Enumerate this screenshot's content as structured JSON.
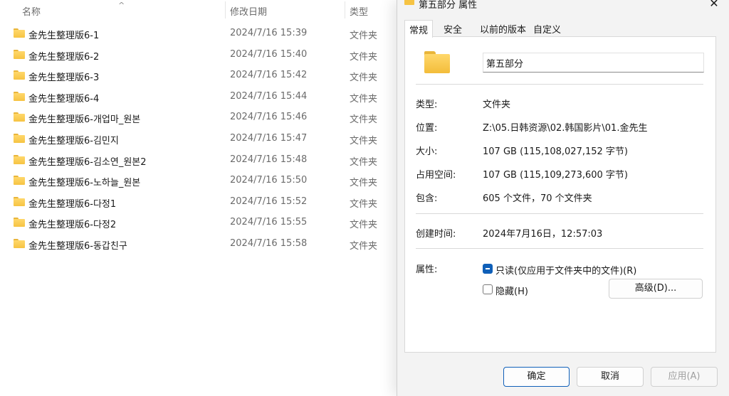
{
  "explorer": {
    "columns": {
      "name": "名称",
      "modified": "修改日期",
      "type": "类型"
    },
    "rows": [
      {
        "name": "金先生整理版6-1",
        "modified": "2024/7/16 15:39",
        "type": "文件夹"
      },
      {
        "name": "金先生整理版6-2",
        "modified": "2024/7/16 15:40",
        "type": "文件夹"
      },
      {
        "name": "金先生整理版6-3",
        "modified": "2024/7/16 15:42",
        "type": "文件夹"
      },
      {
        "name": "金先生整理版6-4",
        "modified": "2024/7/16 15:44",
        "type": "文件夹"
      },
      {
        "name": "金先生整理版6-개업마_원본",
        "modified": "2024/7/16 15:46",
        "type": "文件夹"
      },
      {
        "name": "金先生整理版6-김민지",
        "modified": "2024/7/16 15:47",
        "type": "文件夹"
      },
      {
        "name": "金先生整理版6-김소연_원본2",
        "modified": "2024/7/16 15:48",
        "type": "文件夹"
      },
      {
        "name": "金先生整理版6-노하늘_원본",
        "modified": "2024/7/16 15:50",
        "type": "文件夹"
      },
      {
        "name": "金先生整理版6-다정1",
        "modified": "2024/7/16 15:52",
        "type": "文件夹"
      },
      {
        "name": "金先生整理版6-다정2",
        "modified": "2024/7/16 15:55",
        "type": "文件夹"
      },
      {
        "name": "金先生整理版6-동갑친구",
        "modified": "2024/7/16 15:58",
        "type": "文件夹"
      }
    ]
  },
  "dialog": {
    "title": "第五部分 属性",
    "close_glyph": "✕",
    "tabs": [
      "常规",
      "安全",
      "以前的版本",
      "自定义"
    ],
    "folder_name": "第五部分",
    "props": {
      "type_label": "类型:",
      "type_value": "文件夹",
      "location_label": "位置:",
      "location_value": "Z:\\05.日韩资源\\02.韩国影片\\01.金先生",
      "size_label": "大小:",
      "size_value": "107 GB (115,108,027,152 字节)",
      "disk_label": "占用空间:",
      "disk_value": "107 GB (115,109,273,600 字节)",
      "contains_label": "包含:",
      "contains_value": "605 个文件，70 个文件夹",
      "created_label": "创建时间:",
      "created_value": "2024年7月16日，12:57:03",
      "attributes_label": "属性:"
    },
    "readonly_label": "只读(仅应用于文件夹中的文件)(R)",
    "hidden_label": "隐藏(H)",
    "advanced_label": "高级(D)...",
    "ok_label": "确定",
    "cancel_label": "取消",
    "apply_label": "应用(A)"
  }
}
